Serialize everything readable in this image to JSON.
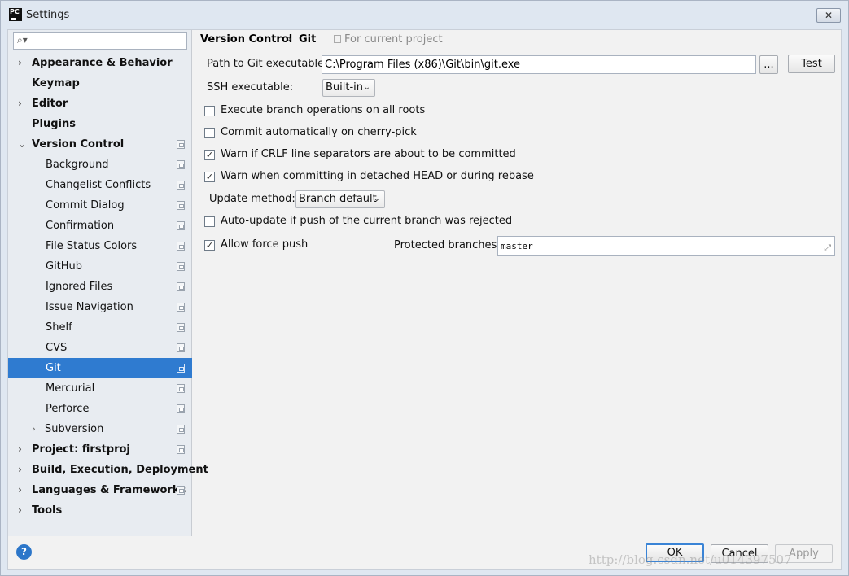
{
  "window": {
    "title": "Settings",
    "app_icon_text": "PC",
    "close_glyph": "✕"
  },
  "search": {
    "value": "",
    "icon": "search-icon"
  },
  "sidebar": {
    "items": [
      {
        "label": "Appearance & Behavior",
        "bold": true,
        "arrow": "›"
      },
      {
        "label": "Keymap",
        "bold": true
      },
      {
        "label": "Editor",
        "bold": true,
        "arrow": "›"
      },
      {
        "label": "Plugins",
        "bold": true
      },
      {
        "label": "Version Control",
        "bold": true,
        "arrow": "⌄"
      },
      {
        "label": "Background"
      },
      {
        "label": "Changelist Conflicts"
      },
      {
        "label": "Commit Dialog"
      },
      {
        "label": "Confirmation"
      },
      {
        "label": "File Status Colors"
      },
      {
        "label": "GitHub"
      },
      {
        "label": "Ignored Files"
      },
      {
        "label": "Issue Navigation"
      },
      {
        "label": "Shelf"
      },
      {
        "label": "CVS"
      },
      {
        "label": "Git",
        "selected": true
      },
      {
        "label": "Mercurial"
      },
      {
        "label": "Perforce"
      },
      {
        "label": "Subversion",
        "arrow": "›"
      },
      {
        "label": "Project: firstproj",
        "bold": true,
        "arrow": "›"
      },
      {
        "label": "Build, Execution, Deployment",
        "bold": true,
        "arrow": "›"
      },
      {
        "label": "Languages & Frameworks",
        "bold": true,
        "arrow": "›"
      },
      {
        "label": "Tools",
        "bold": true,
        "arrow": "›"
      }
    ]
  },
  "header": {
    "crumb_parent": "Version Control",
    "crumb_sep": "›",
    "crumb_current": "Git",
    "project_note": "For current project"
  },
  "git": {
    "path_label": "Path to Git executable:",
    "path_value": "C:\\Program Files (x86)\\Git\\bin\\git.exe",
    "browse_label": "...",
    "test_label": "Test",
    "ssh_label": "SSH executable:",
    "ssh_value": "Built-in",
    "options": [
      {
        "label": "Execute branch operations on all roots",
        "checked": false
      },
      {
        "label": "Commit automatically on cherry-pick",
        "checked": false
      },
      {
        "label": "Warn if CRLF line separators are about to be committed",
        "checked": true
      },
      {
        "label": "Warn when committing in detached HEAD or during rebase",
        "checked": true
      }
    ],
    "update_method_label": "Update method:",
    "update_method_value": "Branch default",
    "auto_update": {
      "label": "Auto-update if push of the current branch was rejected",
      "checked": false
    },
    "force_push": {
      "label": "Allow force push",
      "checked": true
    },
    "protected_label": "Protected branches:",
    "protected_value": "master",
    "check_glyph": "✓",
    "dropdown_glyph": "⌄",
    "expand_glyph": "⤢"
  },
  "footer": {
    "help_label": "?",
    "ok_label": "OK",
    "cancel_label": "Cancel",
    "apply_label": "Apply"
  },
  "watermark": "http://blog.csdn.net/u014397507"
}
